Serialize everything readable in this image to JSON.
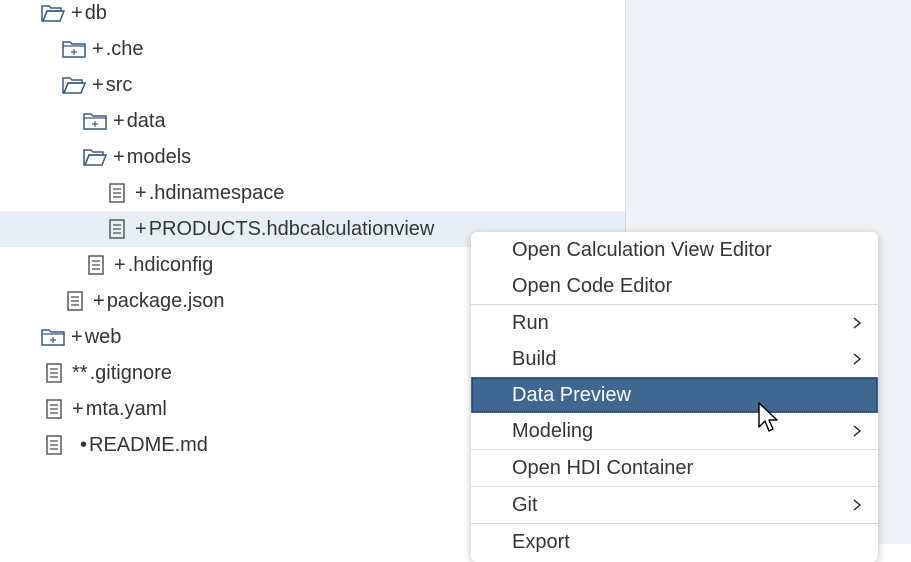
{
  "tree": {
    "items": [
      {
        "status": "+",
        "label": "db",
        "icon": "folder-open-icon"
      },
      {
        "status": "+",
        "label": ".che",
        "icon": "folder-closed-icon"
      },
      {
        "status": "+",
        "label": "src",
        "icon": "folder-open-icon"
      },
      {
        "status": "+",
        "label": "data",
        "icon": "folder-closed-icon"
      },
      {
        "status": "+",
        "label": "models",
        "icon": "folder-open-icon"
      },
      {
        "status": "+",
        "label": ".hdinamespace",
        "icon": "file-icon"
      },
      {
        "status": "+",
        "label": "PRODUCTS.hdbcalculationview",
        "icon": "file-icon"
      },
      {
        "status": "+",
        "label": ".hdiconfig",
        "icon": "file-icon"
      },
      {
        "status": "+",
        "label": "package.json",
        "icon": "file-icon"
      },
      {
        "status": "+",
        "label": "web",
        "icon": "folder-closed-icon"
      },
      {
        "status": "**",
        "label": ".gitignore",
        "icon": "file-icon"
      },
      {
        "status": "+",
        "label": "mta.yaml",
        "icon": "file-icon"
      },
      {
        "status": "•",
        "label": "README.md",
        "icon": "file-icon"
      }
    ]
  },
  "context_menu": {
    "items": [
      {
        "label": "Open Calculation View Editor"
      },
      {
        "label": "Open Code Editor"
      },
      {
        "label": "Run"
      },
      {
        "label": "Build"
      },
      {
        "label": "Data Preview"
      },
      {
        "label": "Modeling"
      },
      {
        "label": "Open HDI Container"
      },
      {
        "label": "Git"
      },
      {
        "label": "Export"
      }
    ]
  },
  "colors": {
    "selected_row": "#e8eef5",
    "menu_highlight": "#3f6791",
    "right_pane": "#eef1f5"
  }
}
